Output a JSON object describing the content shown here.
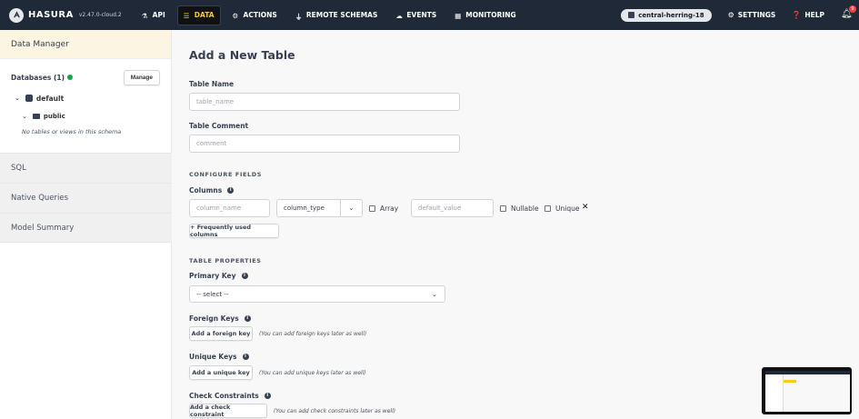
{
  "app": {
    "brand": "HASURA",
    "version": "v2.47.0-cloud.2",
    "accent": "#facc15",
    "nav_bg": "#1f2937"
  },
  "nav": {
    "items": [
      {
        "label": "API",
        "icon": "flask-icon"
      },
      {
        "label": "DATA",
        "icon": "database-icon",
        "active": true
      },
      {
        "label": "ACTIONS",
        "icon": "actions-icon"
      },
      {
        "label": "REMOTE SCHEMAS",
        "icon": "plug-icon"
      },
      {
        "label": "EVENTS",
        "icon": "cloud-icon"
      },
      {
        "label": "MONITORING",
        "icon": "chart-icon"
      }
    ],
    "project": "central-herring-18",
    "settings": "SETTINGS",
    "help": "HELP",
    "notification_count": "9"
  },
  "sidebar": {
    "header": "Data Manager",
    "databases_label": "Databases (1)",
    "manage_label": "Manage",
    "db_name": "default",
    "schema_name": "public",
    "empty_message": "No tables or views in this schema",
    "sections": [
      "SQL",
      "Native Queries",
      "Model Summary"
    ]
  },
  "form": {
    "title": "Add a New Table",
    "table_name_label": "Table Name",
    "table_name_placeholder": "table_name",
    "table_comment_label": "Table Comment",
    "table_comment_placeholder": "comment",
    "configure_fields": "CONFIGURE FIELDS",
    "columns_label": "Columns",
    "column_name_placeholder": "column_name",
    "column_type_placeholder": "column_type",
    "array_label": "Array",
    "default_value_placeholder": "default_value",
    "nullable_label": "Nullable",
    "unique_label": "Unique",
    "frequent_columns_btn": "+ Frequently used columns",
    "table_properties": "TABLE PROPERTIES",
    "primary_key_label": "Primary Key",
    "primary_key_select": "-- select --",
    "foreign_keys_label": "Foreign Keys",
    "add_foreign_key_btn": "Add a foreign key",
    "foreign_key_hint": "(You can add foreign keys later as well)",
    "unique_keys_label": "Unique Keys",
    "add_unique_key_btn": "Add a unique key",
    "unique_key_hint": "(You can add unique keys later as well)",
    "check_constraints_label": "Check Constraints",
    "add_check_constraint_btn": "Add a check constraint",
    "check_constraint_hint": "(You can add check constraints later as well)"
  }
}
